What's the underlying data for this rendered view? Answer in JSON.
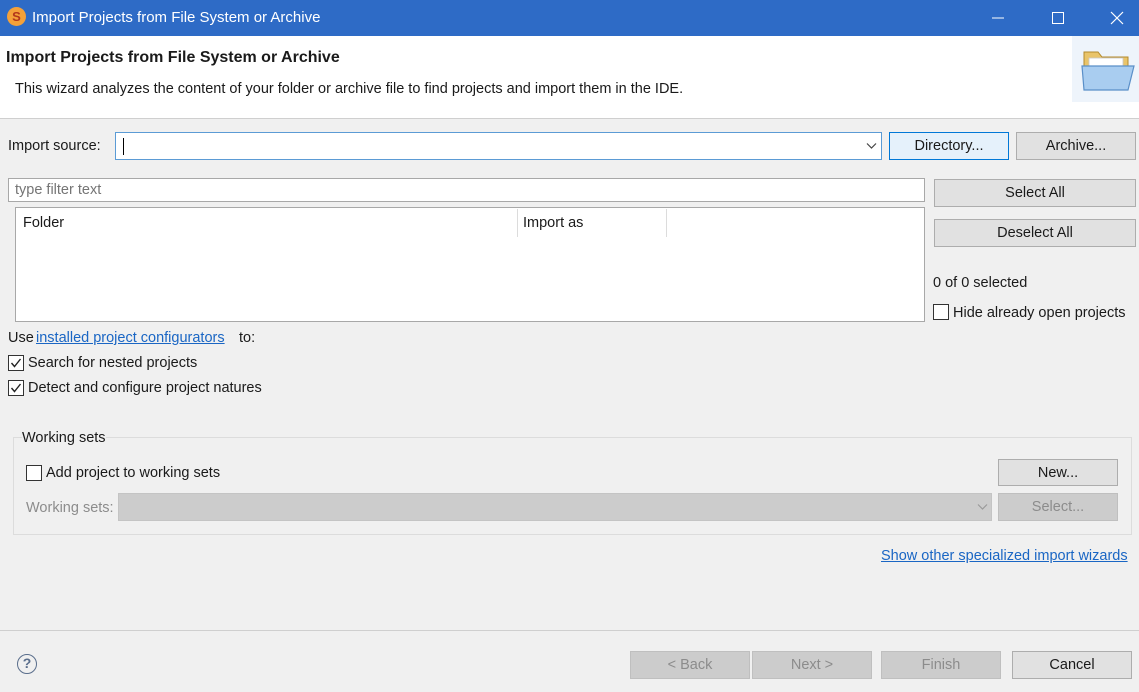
{
  "window": {
    "title": "Import Projects from File System or Archive",
    "app_icon_letter": "S",
    "controls": [
      "minimize-icon",
      "maximize-icon",
      "close-icon"
    ]
  },
  "header": {
    "title": "Import Projects from File System or Archive",
    "description": "This wizard analyzes the content of your folder or archive file to find projects and import them in the IDE.",
    "icon": "folder-open-icon"
  },
  "import_source": {
    "label": "Import source:",
    "value": "",
    "directory_button": "Directory...",
    "archive_button": "Archive..."
  },
  "filter": {
    "placeholder": "type filter text",
    "value": ""
  },
  "table": {
    "columns": [
      "Folder",
      "Import as"
    ],
    "rows": []
  },
  "selection": {
    "select_all": "Select All",
    "deselect_all": "Deselect All",
    "count_text": "0 of 0 selected",
    "hide_open_label": "Hide already open projects",
    "hide_open_checked": false
  },
  "configurators": {
    "prefix": "Use",
    "link": "installed project configurators",
    "suffix": "to:",
    "options": [
      {
        "label": "Search for nested projects",
        "checked": true
      },
      {
        "label": "Detect and configure project natures",
        "checked": true
      }
    ]
  },
  "working_sets": {
    "group_title": "Working sets",
    "add_label": "Add project to working sets",
    "add_checked": false,
    "new_button": "New...",
    "sets_label": "Working sets:",
    "sets_value": "",
    "select_button": "Select..."
  },
  "other_wizards_link": "Show other specialized import wizards",
  "footer": {
    "help": "?",
    "back": "< Back",
    "next": "Next >",
    "finish": "Finish",
    "cancel": "Cancel"
  },
  "colors": {
    "titlebar": "#2e6bc6",
    "link": "#1a66c4",
    "focus_border": "#0078d7"
  }
}
